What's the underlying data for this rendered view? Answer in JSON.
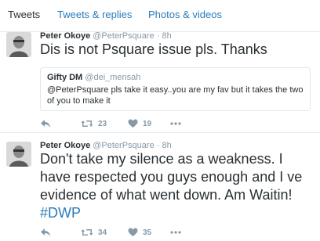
{
  "tabs": {
    "tweets": "Tweets",
    "replies": "Tweets & replies",
    "media": "Photos & videos"
  },
  "tweets": [
    {
      "name": "Peter Okoye",
      "handle": "@PeterPsquare",
      "sep": "·",
      "time": "8h",
      "text": "Dis is not Psquare issue pls. Thanks",
      "quote": {
        "name": "Gifty DM",
        "handle": "@dei_mensah",
        "text": "@PeterPsquare pls take it easy..you are my fav but it takes the two of you to make it"
      },
      "retweets": "23",
      "likes": "19"
    },
    {
      "name": "Peter Okoye",
      "handle": "@PeterPsquare",
      "sep": "·",
      "time": "8h",
      "text": "Don't take my silence as a weakness. I have respected you guys enough and I ve evidence of what went down. Am Waitin! ",
      "hashtag": "#DWP",
      "retweets": "34",
      "likes": "35"
    }
  ],
  "colors": {
    "link": "#2b7bb9",
    "muted": "#8899a6",
    "text": "#292f33",
    "border": "#e1e8ed"
  }
}
